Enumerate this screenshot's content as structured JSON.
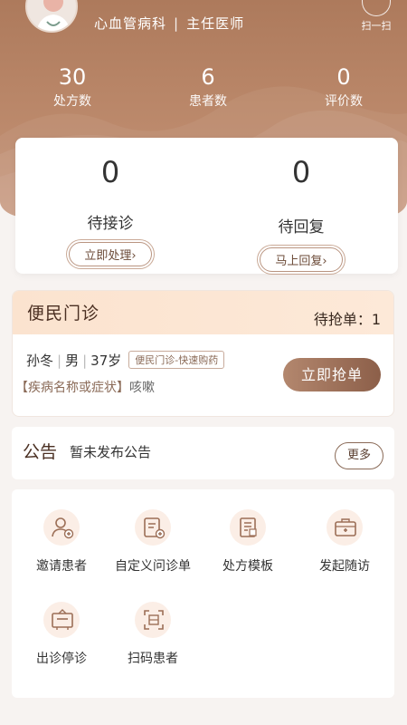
{
  "header": {
    "department": "心血管病科",
    "title": "主任医师",
    "scan_label": "扫一扫"
  },
  "stats": [
    {
      "value": "30",
      "label": "处方数"
    },
    {
      "value": "6",
      "label": "患者数"
    },
    {
      "value": "0",
      "label": "评价数"
    }
  ],
  "pending": [
    {
      "value": "0",
      "label": "待接诊",
      "button": "立即处理›"
    },
    {
      "value": "0",
      "label": "待回复",
      "button": "马上回复›"
    }
  ],
  "clinic": {
    "title": "便民门诊",
    "waiting_label": "待抢单：1",
    "patient": {
      "name": "孙冬",
      "gender": "男",
      "age": "37岁",
      "tag": "便民门诊-快速购药",
      "symptom_label": "【疾病名称或症状】",
      "symptom": "咳嗽"
    },
    "grab_button": "立即抢单"
  },
  "notice": {
    "title": "公告",
    "text": "暂未发布公告",
    "more_button": "更多"
  },
  "tools": [
    {
      "label": "邀请患者",
      "icon": "invite-patient-icon"
    },
    {
      "label": "自定义问诊单",
      "icon": "custom-form-icon"
    },
    {
      "label": "处方模板",
      "icon": "prescription-template-icon"
    },
    {
      "label": "发起随访",
      "icon": "follow-up-icon"
    },
    {
      "label": "出诊停诊",
      "icon": "schedule-board-icon"
    },
    {
      "label": "扫码患者",
      "icon": "scan-patient-icon"
    }
  ],
  "colors": {
    "brand_brown": "#ad7a5c",
    "accent_peach": "#fbe3cf"
  }
}
